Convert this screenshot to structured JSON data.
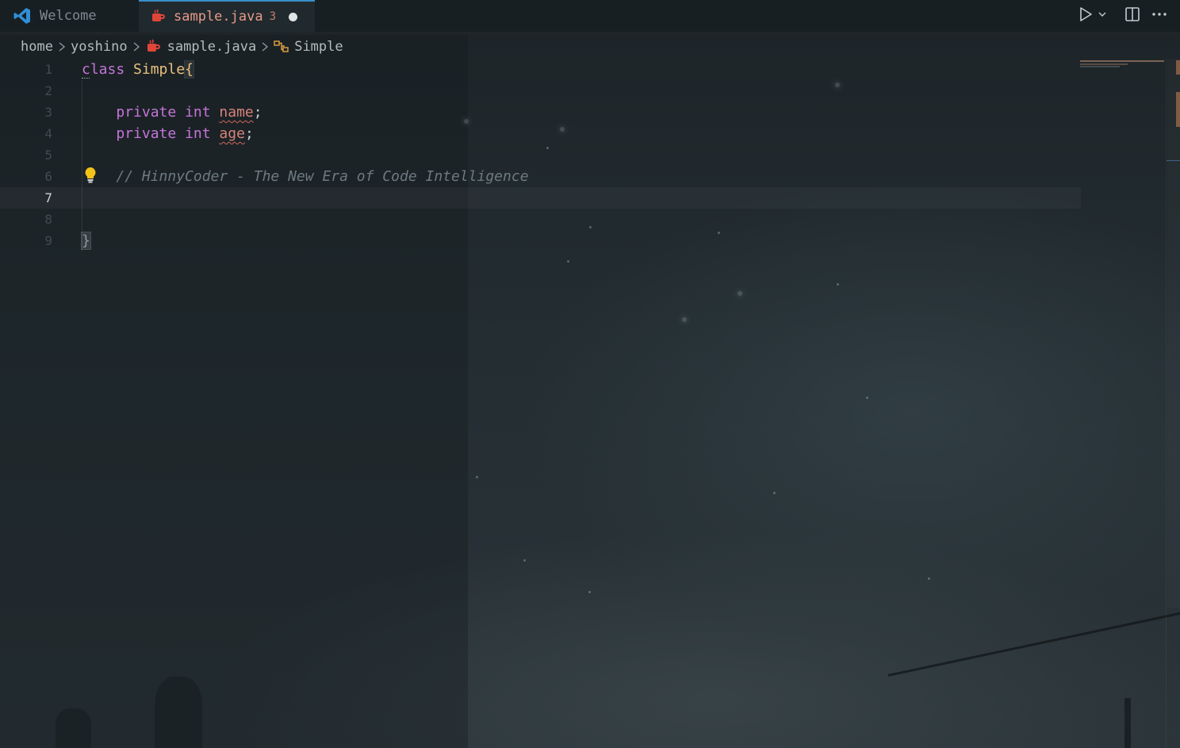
{
  "tabs": [
    {
      "label": "Welcome",
      "icon": "vscode-icon",
      "active": false
    },
    {
      "label": "sample.java",
      "icon": "java-icon",
      "problems": "3",
      "modified": true,
      "active": true
    }
  ],
  "actions": [
    {
      "name": "run-icon"
    },
    {
      "name": "chevron-down-icon"
    },
    {
      "name": "split-editor-icon"
    },
    {
      "name": "more-icon"
    }
  ],
  "breadcrumb": {
    "items": [
      "home",
      "yoshino",
      "sample.java",
      "Simple"
    ]
  },
  "editor": {
    "active_line": "7",
    "line_numbers": [
      "1",
      "2",
      "3",
      "4",
      "5",
      "6",
      "7",
      "8",
      "9"
    ],
    "tokens": {
      "class_kw": "class",
      "class_name": "Simple",
      "open_brace": "{",
      "private_kw": "private",
      "int_kw": "int",
      "field1": "name",
      "field2": "age",
      "semi": ";",
      "comment": "// HinnyCoder - The New Era of Code Intelligence",
      "close_brace": "}"
    }
  },
  "colors": {
    "keyword": "#c475d8",
    "type": "#e8c07d",
    "error": "#d7827a",
    "comment": "#6e7a80",
    "tab_accent": "#3a8ec9"
  }
}
